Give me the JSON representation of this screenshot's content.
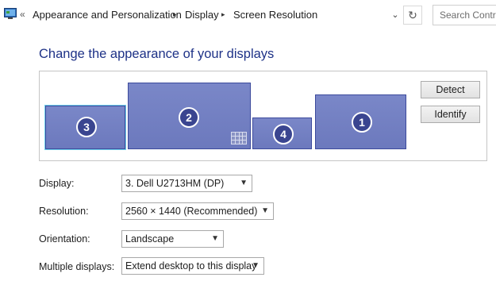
{
  "address_bar": {
    "overflow_glyph": "«",
    "breadcrumbs": [
      "Appearance and Personalization",
      "Display",
      "Screen Resolution"
    ],
    "separator_glyph": "▸",
    "dropdown_glyph": "⌄",
    "refresh_glyph": "↻",
    "search_placeholder": "Search Control Panel"
  },
  "heading": "Change the appearance of your displays",
  "arrangement": {
    "monitors": [
      {
        "number": "3",
        "selected": true
      },
      {
        "number": "2",
        "selected": false
      },
      {
        "number": "4",
        "selected": false
      },
      {
        "number": "1",
        "selected": false
      }
    ],
    "detect_label": "Detect",
    "identify_label": "Identify"
  },
  "settings": {
    "display": {
      "label": "Display:",
      "value": "3. Dell U2713HM (DP)"
    },
    "resolution": {
      "label": "Resolution:",
      "value": "2560 × 1440 (Recommended)"
    },
    "orientation": {
      "label": "Orientation:",
      "value": "Landscape"
    },
    "multiple_displays": {
      "label": "Multiple displays:",
      "value": "Extend desktop to this display"
    }
  },
  "colors": {
    "heading": "#1e3287",
    "monitor_fill": "#7080c2",
    "badge": "#3a4590",
    "selected_outline": "#6ed0ec"
  }
}
